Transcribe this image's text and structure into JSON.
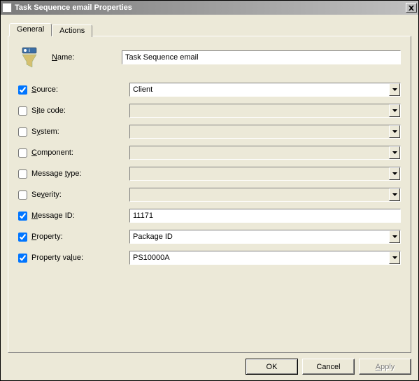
{
  "window": {
    "title": "Task Sequence email Properties"
  },
  "tabs": {
    "general": "General",
    "actions": "Actions"
  },
  "form": {
    "name_label": "Name:",
    "name_value": "Task Sequence email",
    "rows": [
      {
        "label": "Source:",
        "checked": true,
        "type": "select",
        "value": "Client",
        "enabled": true
      },
      {
        "label": "Site code:",
        "checked": false,
        "type": "select",
        "value": "",
        "enabled": false
      },
      {
        "label": "System:",
        "checked": false,
        "type": "select",
        "value": "",
        "enabled": false
      },
      {
        "label": "Component:",
        "checked": false,
        "type": "select",
        "value": "",
        "enabled": false
      },
      {
        "label": "Message type:",
        "checked": false,
        "type": "select",
        "value": "",
        "enabled": false
      },
      {
        "label": "Severity:",
        "checked": false,
        "type": "select",
        "value": "",
        "enabled": false
      },
      {
        "label": "Message ID:",
        "checked": true,
        "type": "text",
        "value": "11171",
        "enabled": true
      },
      {
        "label": "Property:",
        "checked": true,
        "type": "select",
        "value": "Package ID",
        "enabled": true
      },
      {
        "label": "Property value:",
        "checked": true,
        "type": "select",
        "value": "PS10000A",
        "enabled": true
      }
    ],
    "underlined": [
      "S",
      "i",
      "y",
      "C",
      "t",
      "v",
      "M",
      "P",
      "l"
    ]
  },
  "buttons": {
    "ok": "OK",
    "cancel": "Cancel",
    "apply": "Apply"
  }
}
